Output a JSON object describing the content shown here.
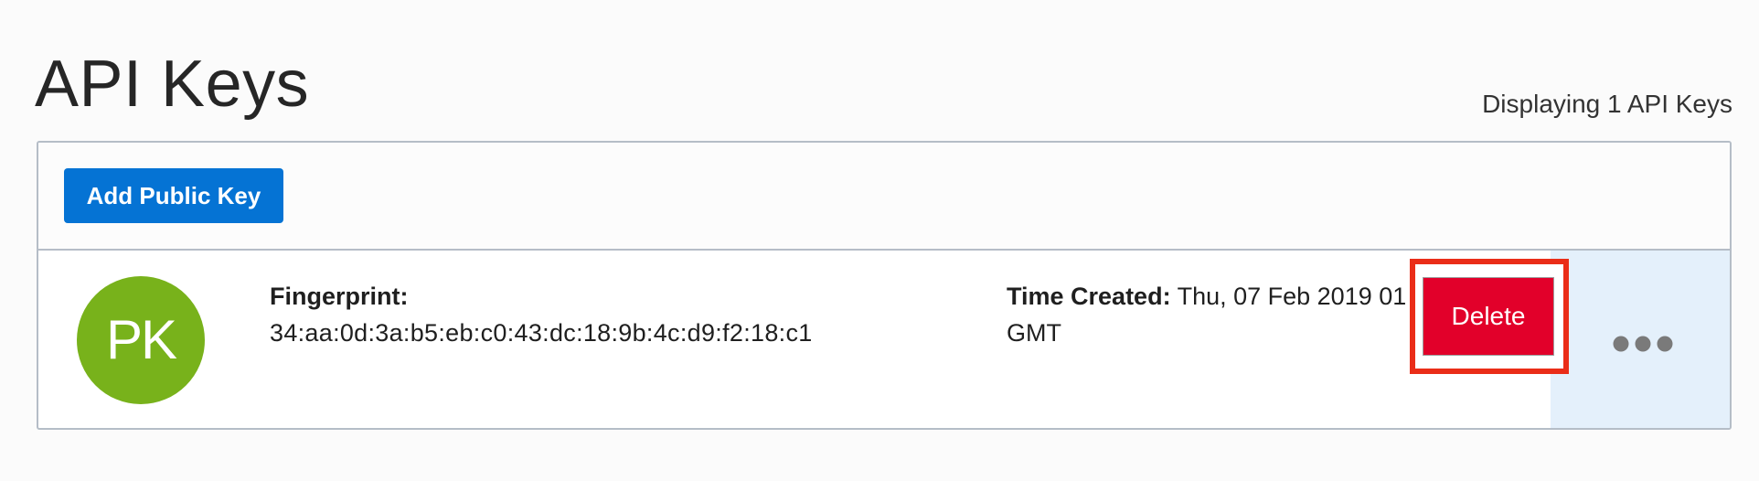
{
  "page": {
    "title": "API Keys",
    "count_text": "Displaying 1 API Keys"
  },
  "toolbar": {
    "add_button_label": "Add Public Key"
  },
  "keys": [
    {
      "avatar_initials": "PK",
      "fingerprint_label": "Fingerprint:",
      "fingerprint_value": "34:aa:0d:3a:b5:eb:c0:43:dc:18:9b:4c:d9:f2:18:c1",
      "time_created_label": "Time Created:",
      "time_created_value": "Thu, 07 Feb 2019 01",
      "time_created_timezone": "GMT",
      "actions_icon": "more-horizontal-icon"
    }
  ],
  "context_menu": {
    "delete_label": "Delete"
  },
  "colors": {
    "primary_button": "#0573d4",
    "avatar": "#78b21b",
    "danger": "#e2002a",
    "highlight_outline": "#ea2d18",
    "actions_background": "#e4f0fb"
  }
}
